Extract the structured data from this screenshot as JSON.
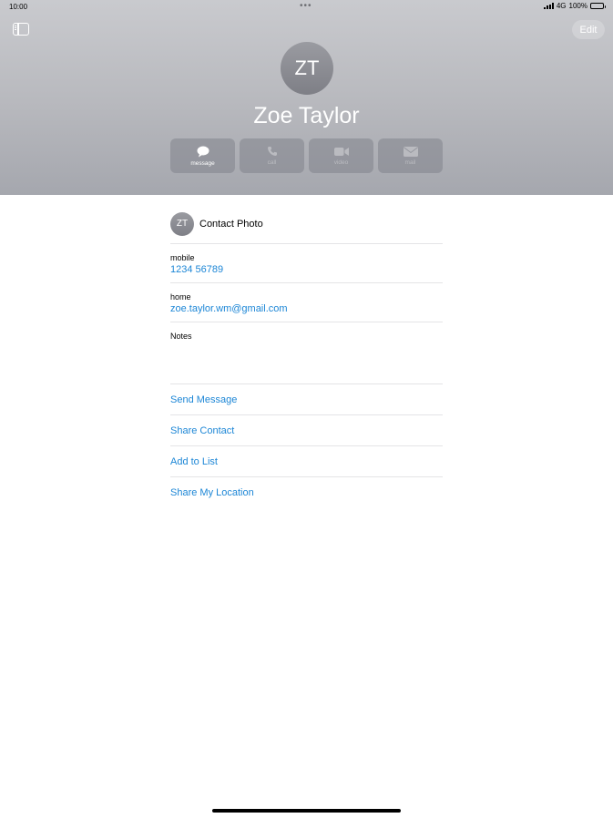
{
  "status_bar": {
    "time": "10:00",
    "dots": "•••",
    "network": "4G",
    "battery": "100%"
  },
  "toolbar": {
    "edit_label": "Edit"
  },
  "contact": {
    "initials": "ZT",
    "name": "Zoe Taylor"
  },
  "actions": [
    {
      "label": "message",
      "icon": "message-icon",
      "enabled": true
    },
    {
      "label": "call",
      "icon": "phone-icon",
      "enabled": false
    },
    {
      "label": "video",
      "icon": "video-icon",
      "enabled": false
    },
    {
      "label": "mail",
      "icon": "mail-icon",
      "enabled": false
    }
  ],
  "details": {
    "photo_label": "Contact Photo",
    "fields": [
      {
        "label": "mobile",
        "value": "1234 56789"
      },
      {
        "label": "home",
        "value": "zoe.taylor.wm@gmail.com"
      }
    ],
    "notes_label": "Notes"
  },
  "links": [
    "Send Message",
    "Share Contact",
    "Add to List",
    "Share My Location"
  ],
  "colors": {
    "accent": "#1c86d6",
    "header_top": "#c9cace",
    "header_bottom": "#a5a7ae"
  }
}
